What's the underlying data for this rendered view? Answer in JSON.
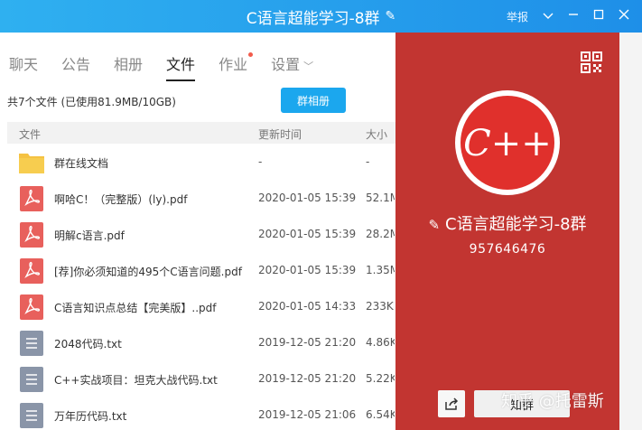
{
  "window": {
    "title": "C语言超能学习-8群",
    "report": "举报",
    "colors": {
      "titlebar": "#1ba7ee",
      "panel": "#c23531",
      "pdf": "#e8605c",
      "txt": "#8a95a8"
    }
  },
  "tabs": [
    {
      "label": "聊天"
    },
    {
      "label": "公告"
    },
    {
      "label": "相册"
    },
    {
      "label": "文件",
      "active": true
    },
    {
      "label": "作业",
      "has_dot": true
    },
    {
      "label": "设置",
      "has_chevron": true
    }
  ],
  "files": {
    "summary": "共7个文件 (已使用81.9MB/10GB)",
    "album_button": "群相册",
    "columns": {
      "name": "文件",
      "time": "更新时间",
      "size": "大小"
    },
    "rows": [
      {
        "icon": "folder-icon",
        "name": "群在线文档",
        "time": "-",
        "size": "-"
      },
      {
        "icon": "pdf-icon",
        "name": "啊哈C！（完整版）(ly).pdf",
        "time": "2020-01-05 15:39",
        "size": "52.1M"
      },
      {
        "icon": "pdf-icon",
        "name": "明解c语言.pdf",
        "time": "2020-01-05 15:39",
        "size": "28.2M"
      },
      {
        "icon": "pdf-icon",
        "name": "[荐]你必须知道的495个C语言问题.pdf",
        "time": "2020-01-05 15:39",
        "size": "1.35M"
      },
      {
        "icon": "pdf-icon",
        "name": "C语言知识点总结【完美版】..pdf",
        "time": "2020-01-05 14:33",
        "size": "233KE"
      },
      {
        "icon": "txt-icon",
        "name": "2048代码.txt",
        "time": "2019-12-05 21:20",
        "size": "4.86K"
      },
      {
        "icon": "txt-icon",
        "name": "C++实战项目：坦克大战代码.txt",
        "time": "2019-12-05 21:20",
        "size": "5.22K"
      },
      {
        "icon": "txt-icon",
        "name": "万年历代码.txt",
        "time": "2019-12-05 21:06",
        "size": "6.54K"
      }
    ]
  },
  "group": {
    "logo_text": "C++",
    "name": "C语言超能学习-8群",
    "number": "957646476",
    "enter_button": "知群",
    "watermark": "知乎 @托雷斯"
  }
}
